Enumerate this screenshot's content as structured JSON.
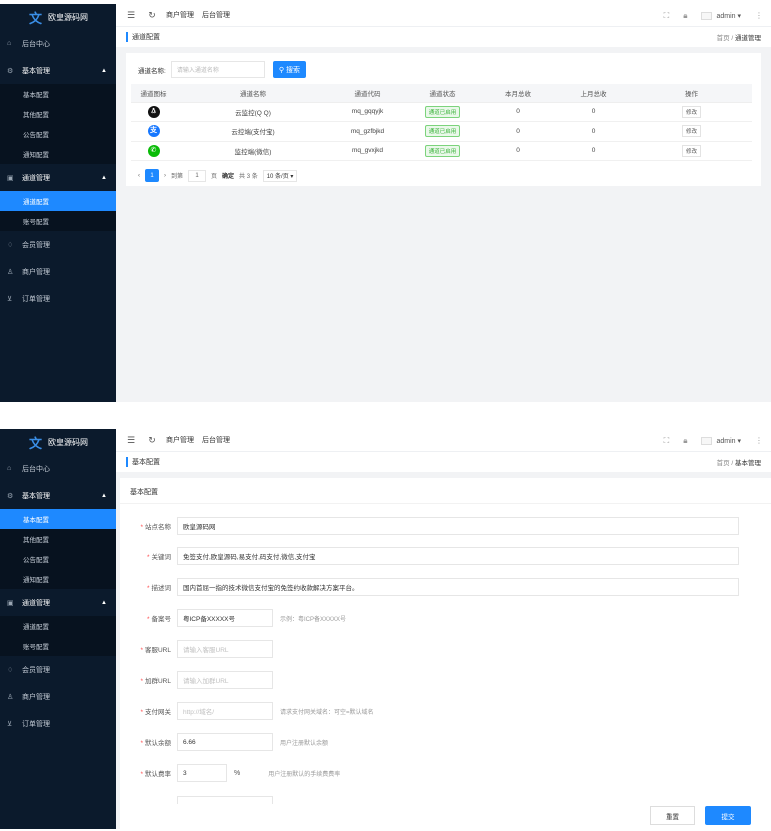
{
  "app": {
    "logo_text": "欧皇源码网",
    "logo_mark": "文"
  },
  "topbar": {
    "nav": [
      "商户管理",
      "后台管理"
    ],
    "user": "admin ▾"
  },
  "sidebar": {
    "home": "后台中心",
    "groups": [
      {
        "label": "基本管理",
        "items": [
          "基本配置",
          "其他配置",
          "公告配置",
          "通知配置"
        ]
      },
      {
        "label": "通道管理",
        "items": [
          "通道配置",
          "账号配置"
        ]
      }
    ],
    "others": [
      "会员管理",
      "商户管理",
      "订单管理"
    ]
  },
  "screen1": {
    "crumb_title": "通道配置",
    "crumb_home": "首页",
    "crumb_current": "通道管理",
    "search": {
      "label": "通道名称:",
      "placeholder": "请输入通道名称",
      "button": "搜索"
    },
    "columns": [
      "通道图标",
      "通道名称",
      "通道代码",
      "通道状态",
      "本月总收",
      "上月总收",
      "操作"
    ],
    "rows": [
      {
        "icon": "qq-icon",
        "name": "云监控(Q Q)",
        "code": "mq_gqqyjk",
        "status": "通道已启用",
        "this_month": "0",
        "last_month": "0",
        "action": "修改"
      },
      {
        "icon": "alipay-icon",
        "name": "云控端(支付宝)",
        "code": "mq_gzfbjkd",
        "status": "通道已启用",
        "this_month": "0",
        "last_month": "0",
        "action": "修改"
      },
      {
        "icon": "wechat-icon",
        "name": "监控端(微信)",
        "code": "mq_gvxjkd",
        "status": "通道已启用",
        "this_month": "0",
        "last_month": "0",
        "action": "修改"
      }
    ],
    "pager": {
      "current": "1",
      "goto": "到第",
      "page_value": "1",
      "page_unit": "页",
      "confirm": "确定",
      "total": "共 3 条",
      "page_size": "10 条/页 ▾"
    }
  },
  "screen2": {
    "crumb_title": "基本配置",
    "crumb_home": "首页",
    "crumb_current": "基本管理",
    "section_title": "基本配置",
    "fields": [
      {
        "label": "站点名称",
        "value": "欧皇源码网",
        "placeholder": "",
        "hint": ""
      },
      {
        "label": "关键词",
        "value": "免签支付,欧皇源码,易支付,码支付,微信,支付宝",
        "placeholder": "",
        "hint": ""
      },
      {
        "label": "描述词",
        "value": "国内首屈一指的技术微信支付宝的免签约收款解决方案平台。",
        "placeholder": "",
        "hint": ""
      },
      {
        "label": "备案号",
        "value": "粤ICP备XXXXX号",
        "placeholder": "",
        "hint": "示例：粤ICP备XXXXX号"
      },
      {
        "label": "客服URL",
        "value": "",
        "placeholder": "请输入客服URL",
        "hint": ""
      },
      {
        "label": "加群URL",
        "value": "",
        "placeholder": "请输入加群URL",
        "hint": ""
      },
      {
        "label": "支付网关",
        "value": "",
        "placeholder": "http://域名/",
        "hint": "请求支付网关域名：可空=默认域名"
      },
      {
        "label": "默认余额",
        "value": "6.66",
        "placeholder": "",
        "hint": "用户注册默认余额"
      },
      {
        "label": "默认费率",
        "value": "3",
        "placeholder": "",
        "hint": "用户注册默认的手续费费率",
        "unit": "%"
      }
    ],
    "buttons": {
      "reset": "重置",
      "submit": "提交"
    }
  },
  "colors": {
    "sidebar": "#0b1a2c",
    "accent": "#1e89ff",
    "status_green": "#3bb33b"
  }
}
